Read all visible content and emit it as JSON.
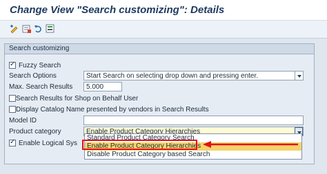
{
  "window": {
    "title": "Change View \"Search customizing\": Details"
  },
  "toolbar": {
    "icons": [
      "display-change-icon",
      "new-entries-icon",
      "undo-icon",
      "select-icon"
    ]
  },
  "group": {
    "title": "Search customizing"
  },
  "fields": {
    "fuzzy_search": {
      "label": "Fuzzy Search",
      "checked": true
    },
    "search_options": {
      "label": "Search Options",
      "value": "Start Search on selecting drop down and pressing enter."
    },
    "max_results": {
      "label": "Max. Search Results",
      "value": "5.000"
    },
    "search_behalf": {
      "label": "Search Results for Shop on Behalf User",
      "checked": false
    },
    "display_catalog": {
      "label": "Display Catalog Name presented by vendors in Search Results",
      "checked": false
    },
    "model_id": {
      "label": "Model ID",
      "value": ""
    },
    "product_category": {
      "label": "Product category",
      "value": "Enable Product Category Hierarchies"
    },
    "logical_sys": {
      "label": "Enable Logical Sys",
      "checked": true
    }
  },
  "dropdown": {
    "options": [
      "Standard Product Category Search",
      "Enable Product Category Hierarchies",
      "Disable Product Category based Search"
    ],
    "selected_index": 1
  },
  "colors": {
    "highlight": "#e3101a",
    "selected_option": "#f5d36b",
    "title": "#1f3a5f"
  }
}
